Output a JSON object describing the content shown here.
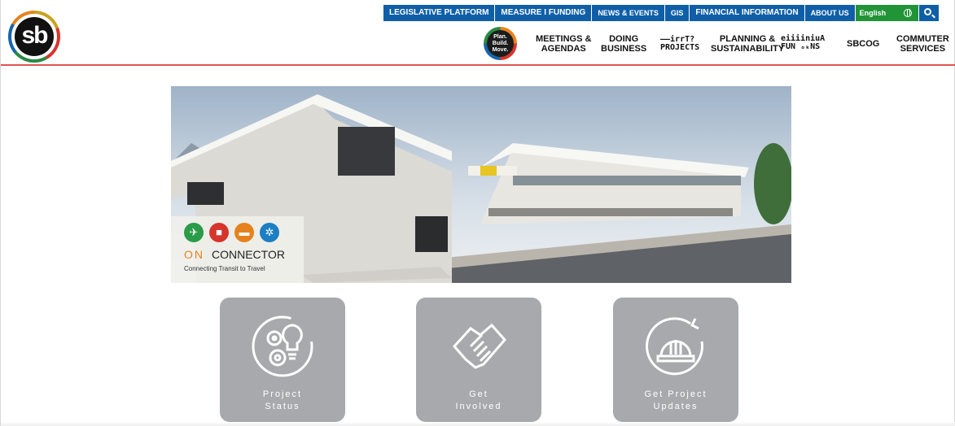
{
  "topbar": {
    "items": [
      "LEGISLATIVE PLATFORM",
      "MEASURE I FUNDING",
      "NEWS & EVENTS",
      "GIS",
      "FINANCIAL INFORMATION",
      "ABOUT US"
    ],
    "language": "English",
    "color": "#0f5fa8",
    "lang_color": "#219438"
  },
  "logo": {
    "text": "sb"
  },
  "plan_badge": {
    "text": "Plan.\nBuild.\nMove."
  },
  "nav": {
    "meetings": "MEETINGS &\nAGENDAS",
    "doing_business": "DOING\nBUSINESS",
    "projects": "——irrT?\nPROJECTS",
    "planning": "PLANNING &\nSUSTAINABILITY",
    "funding": "eiiiiniuA\nFUN ₒₖNS",
    "sbcog": "SBCOG",
    "commuter": "COMMUTER\nSERVICES"
  },
  "hero": {
    "badge_on": "ON",
    "badge_connector": "CONNECTOR",
    "badge_tagline": "Connecting Transit to Travel",
    "icons": [
      "plane-icon",
      "train-icon",
      "bus-icon",
      "bike-wheel-icon"
    ],
    "icon_colors": [
      "#2a9b47",
      "#d6352b",
      "#e6821d",
      "#1c7fc4"
    ]
  },
  "cards": [
    {
      "label": "Project\nStatus",
      "icon": "gears-lightbulb-icon"
    },
    {
      "label": "Get\nInvolved",
      "icon": "handshake-icon"
    },
    {
      "label": "Get Project\nUpdates",
      "icon": "hardhat-refresh-icon"
    }
  ],
  "accent": "#e05555"
}
